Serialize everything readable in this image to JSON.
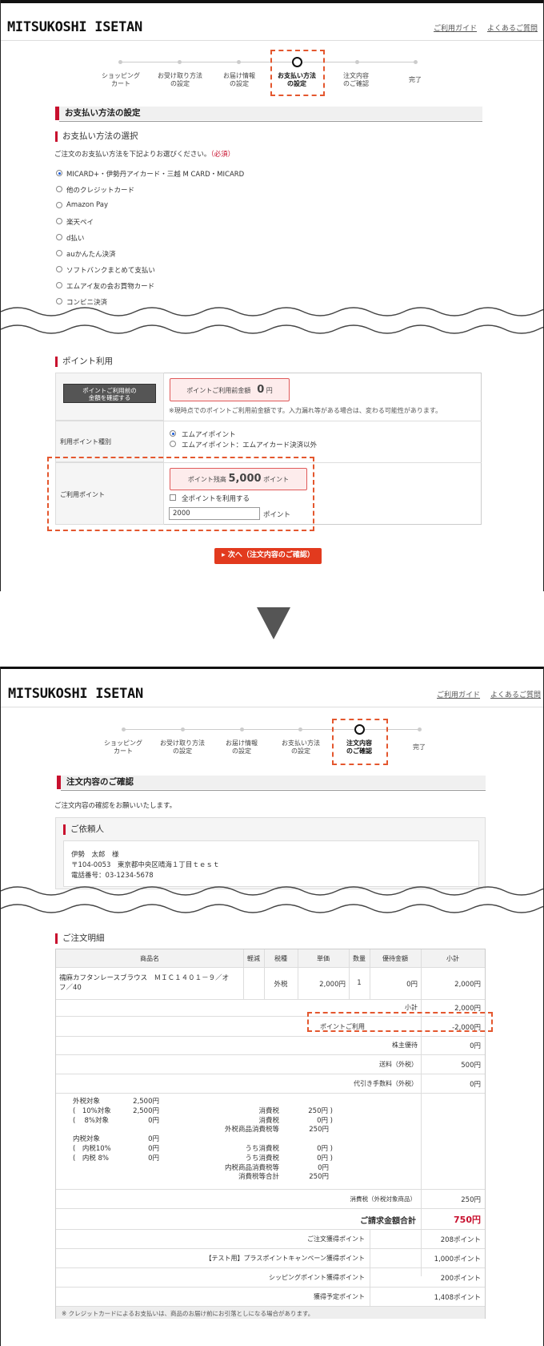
{
  "header": {
    "logo": "MITSUKOSHI ISETAN",
    "guide_link": "ご利用ガイド",
    "faq_link": "よくあるご質問"
  },
  "steps": [
    {
      "l1": "ショッピング",
      "l2": "カート"
    },
    {
      "l1": "お受け取り方法",
      "l2": "の設定"
    },
    {
      "l1": "お届け情報",
      "l2": "の設定"
    },
    {
      "l1": "お支払い方法",
      "l2": "の設定"
    },
    {
      "l1": "注文内容",
      "l2": "のご確認"
    },
    {
      "l1": "完了",
      "l2": ""
    }
  ],
  "payment": {
    "section_title": "お支払い方法の設定",
    "select_title": "お支払い方法の選択",
    "instruction": "ご注文のお支払い方法を下記よりお選びください。",
    "required": "（必須）",
    "options": [
      "MICARD+・伊勢丹アイカード・三越 M CARD・MICARD",
      "他のクレジットカード",
      "Amazon Pay",
      "楽天ペイ",
      "d払い",
      "auかんたん決済",
      "ソフトバンクまとめて支払い",
      "エムアイ友の会お買物カード",
      "コンビニ決済"
    ]
  },
  "points": {
    "title": "ポイント利用",
    "check_button": "ポイントご利用前の金額を確認する",
    "check_button_l1": "ポイントご利用前の",
    "check_button_l2": "金額を確認する",
    "pre_amount_label": "ポイントご利用前金額",
    "pre_amount_value": "0",
    "pre_amount_unit": "円",
    "note": "※現時点でのポイントご利用前金額です。入力漏れ等がある場合は、変わる可能性があります。",
    "type_label": "利用ポイント種別",
    "type_options": [
      "エムアイポイント",
      "エムアイポイント：エムアイカード決済以外"
    ],
    "use_label": "ご利用ポイント",
    "balance_label": "ポイント残高",
    "balance_value": "5,000",
    "balance_unit": "ポイント",
    "use_all": "全ポイントを利用する",
    "input_value": "2000",
    "input_unit": "ポイント"
  },
  "next_button": "▸ 次へ（注文内容のご確認）",
  "confirm": {
    "section_title": "注文内容のご確認",
    "instruction": "ご注文内容の確認をお願いいたします。",
    "requester_title": "ご依頼人",
    "name": "伊勢　太郎　様",
    "address": "〒104-0053　東京都中央区晴海１丁目ｔｅｓｔ",
    "phone": "電話番号：03-1234-5678",
    "detail_title": "ご注文明細",
    "table_headers": [
      "商品名",
      "軽減",
      "税種",
      "単価",
      "数量",
      "優待金額",
      "小計"
    ],
    "item": {
      "name_l1": "襦麻カフタンレースブラウス　ＭＩＣ１４０１－９／オ",
      "name_l2": "フ／40",
      "tax_type": "外税",
      "unit_price": "2,000円",
      "qty": "1",
      "discount": "0円",
      "subtotal": "2,000円"
    },
    "rows": [
      {
        "label": "小計",
        "value": "2,000円"
      },
      {
        "label": "ポイントご利用",
        "value": "-2,000円"
      },
      {
        "label": "株主優待",
        "value": "0円"
      },
      {
        "label": "送料（外税）",
        "value": "500円"
      },
      {
        "label": "代引き手数料（外税）",
        "value": "0円"
      }
    ],
    "tax_breakdown": [
      {
        "a": "外税対象",
        "b": "2,500円",
        "c": "",
        "d": ""
      },
      {
        "a": "(　10%対象",
        "b": "2,500円",
        "c": "消費税",
        "d": "250円 )"
      },
      {
        "a": "(　 8%対象",
        "b": "0円",
        "c": "消費税",
        "d": "0円 )"
      },
      {
        "a": "",
        "b": "",
        "c": "外税商品消費税等",
        "d": "250円"
      },
      {
        "a": "内税対象",
        "b": "0円",
        "c": "",
        "d": ""
      },
      {
        "a": "(　内税10%",
        "b": "0円",
        "c": "うち消費税",
        "d": "0円 )"
      },
      {
        "a": "(　内税 8%",
        "b": "0円",
        "c": "うち消費税",
        "d": "0円 )"
      },
      {
        "a": "",
        "b": "",
        "c": "内税商品消費税等",
        "d": "0円"
      },
      {
        "a": "",
        "b": "",
        "c": "消費税等合計",
        "d": "250円"
      }
    ],
    "tax_total_label": "消費税（外税対象商品）",
    "tax_total_value": "250円",
    "grand_label": "ご請求金額合計",
    "grand_value": "750円",
    "point_rows": [
      {
        "label": "ご注文獲得ポイント",
        "value": "208ポイント"
      },
      {
        "label": "【テスト用】プラスポイントキャンペーン獲得ポイント",
        "value": "1,000ポイント"
      },
      {
        "label": "シッピングポイント獲得ポイント",
        "value": "200ポイント"
      },
      {
        "label": "獲得予定ポイント",
        "value": "1,408ポイント"
      }
    ],
    "footnote": "※ クレジットカードによるお支払いは、商品のお届け前にお引落としになる場合があります。"
  },
  "colors": {
    "accent": "#c8102e",
    "highlight": "#e4572e",
    "button": "#e23a1e"
  }
}
